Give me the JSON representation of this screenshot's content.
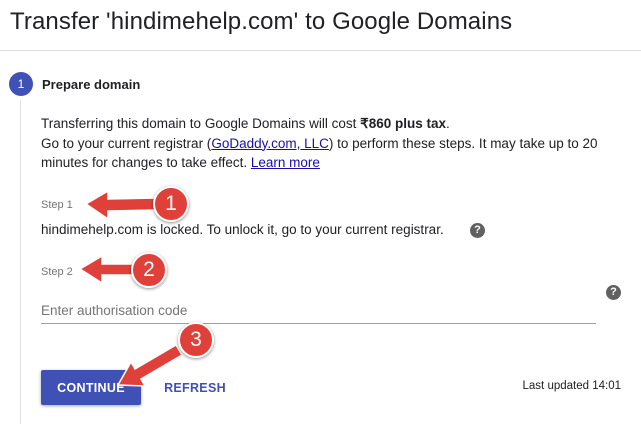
{
  "page_title": "Transfer 'hindimehelp.com' to Google Domains",
  "step": {
    "number": "1",
    "title": "Prepare domain"
  },
  "description": {
    "line1_prefix": "Transferring this domain to Google Domains will cost ",
    "cost": "₹860 plus tax",
    "line1_suffix": ".",
    "line2_prefix": "Go to your current registrar (",
    "registrar_link": "GoDaddy.com, LLC",
    "line2_suffix": ") to perform these steps. It may take up to 20 minutes for changes to take effect. ",
    "learn_more": "Learn more"
  },
  "step1": {
    "label": "Step 1",
    "text": "hindimehelp.com is locked. To unlock it, go to your current registrar."
  },
  "step2": {
    "label": "Step 2",
    "input_placeholder": "Enter authorisation code",
    "input_value": ""
  },
  "help_icon_glyph": "?",
  "actions": {
    "continue_label": "CONTINUE",
    "refresh_label": "REFRESH",
    "last_updated": "Last updated 14:01"
  },
  "annotations": {
    "badge1": "1",
    "badge2": "2",
    "badge3": "3",
    "color": "#e0403a"
  },
  "colors": {
    "primary": "#3f51b5",
    "link": "#1a0dab",
    "muted": "#757575"
  }
}
